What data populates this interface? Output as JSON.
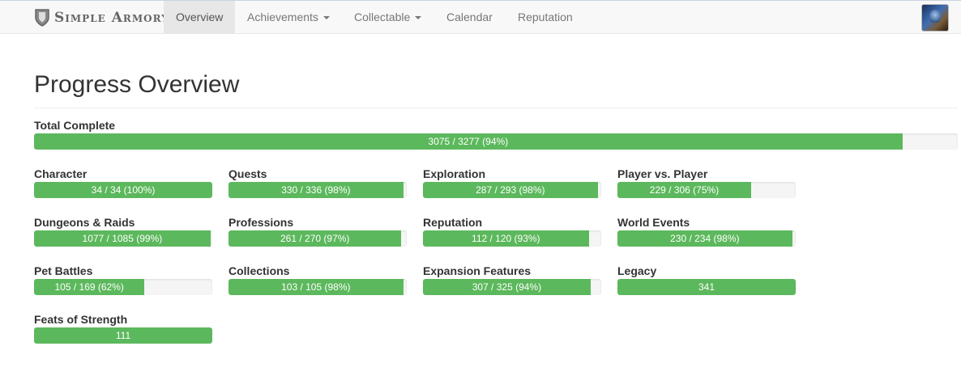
{
  "navbar": {
    "brand": "Simple Armory",
    "items": [
      {
        "label": "Overview",
        "active": true,
        "dropdown": false
      },
      {
        "label": "Achievements",
        "active": false,
        "dropdown": true
      },
      {
        "label": "Collectable",
        "active": false,
        "dropdown": true
      },
      {
        "label": "Calendar",
        "active": false,
        "dropdown": false
      },
      {
        "label": "Reputation",
        "active": false,
        "dropdown": false
      }
    ],
    "avatar_icon": "character-avatar-icon"
  },
  "page": {
    "title": "Progress Overview"
  },
  "colors": {
    "bar": "#5cb85c",
    "track": "#f5f5f5"
  },
  "total": {
    "label": "Total Complete",
    "text": "3075 / 3277 (94%)",
    "percent": 94
  },
  "categories": [
    {
      "label": "Character",
      "text": "34 / 34 (100%)",
      "percent": 100
    },
    {
      "label": "Quests",
      "text": "330 / 336 (98%)",
      "percent": 98
    },
    {
      "label": "Exploration",
      "text": "287 / 293 (98%)",
      "percent": 98
    },
    {
      "label": "Player vs. Player",
      "text": "229 / 306 (75%)",
      "percent": 75
    },
    {
      "label": "Dungeons & Raids",
      "text": "1077 / 1085 (99%)",
      "percent": 99
    },
    {
      "label": "Professions",
      "text": "261 / 270 (97%)",
      "percent": 97
    },
    {
      "label": "Reputation",
      "text": "112 / 120 (93%)",
      "percent": 93
    },
    {
      "label": "World Events",
      "text": "230 / 234 (98%)",
      "percent": 98
    },
    {
      "label": "Pet Battles",
      "text": "105 / 169 (62%)",
      "percent": 62
    },
    {
      "label": "Collections",
      "text": "103 / 105 (98%)",
      "percent": 98
    },
    {
      "label": "Expansion Features",
      "text": "307 / 325 (94%)",
      "percent": 94
    },
    {
      "label": "Legacy",
      "text": "341",
      "percent": 100
    },
    {
      "label": "Feats of Strength",
      "text": "111",
      "percent": 100
    }
  ]
}
